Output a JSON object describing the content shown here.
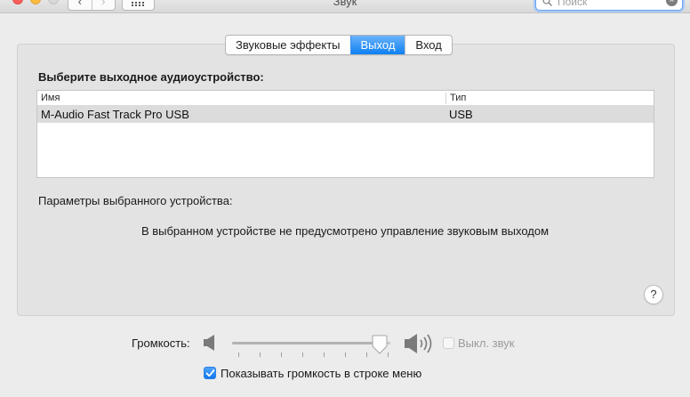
{
  "window": {
    "title": "Звук",
    "search_placeholder": "Поиск",
    "nav_back": "‹",
    "nav_forward": "›"
  },
  "tabs": [
    {
      "label": "Звуковые эффекты",
      "active": false
    },
    {
      "label": "Выход",
      "active": true
    },
    {
      "label": "Вход",
      "active": false
    }
  ],
  "output": {
    "section_label": "Выберите выходное аудиоустройство:",
    "columns": {
      "name": "Имя",
      "type": "Тип"
    },
    "devices": [
      {
        "name": "M-Audio Fast Track Pro USB",
        "type": "USB",
        "selected": true
      }
    ],
    "params_label": "Параметры выбранного устройства:",
    "no_control_message": "В выбранном устройстве не предусмотрено управление звуковым выходом"
  },
  "help": {
    "label": "?"
  },
  "volume": {
    "label": "Громкость:",
    "level": 0.95,
    "mute_label": "Выкл. звук",
    "mute_checked": false,
    "mute_enabled": false,
    "show_in_menu_label": "Показывать громкость в строке меню",
    "show_in_menu_checked": true
  },
  "colors": {
    "accent": "#0d80f2",
    "tab_active_top": "#6cb3fa",
    "selected_row": "#dcdcdc"
  }
}
